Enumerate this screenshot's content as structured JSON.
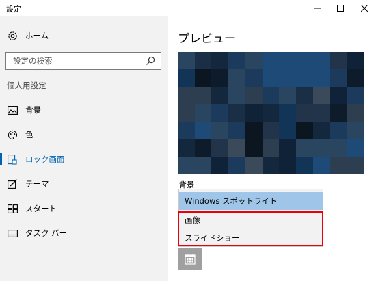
{
  "window": {
    "title": "設定"
  },
  "sidebar": {
    "home_label": "ホーム",
    "search_placeholder": "設定の検索",
    "section_header": "個人用設定",
    "items": [
      {
        "label": "背景"
      },
      {
        "label": "色"
      },
      {
        "label": "ロック画面"
      },
      {
        "label": "テーマ"
      },
      {
        "label": "スタート"
      },
      {
        "label": "タスク バー"
      }
    ],
    "active_item": "ロック画面"
  },
  "main": {
    "preview_title": "プレビュー",
    "background_label": "背景",
    "dropdown_options": [
      {
        "label": "Windows スポットライト",
        "selected": true
      },
      {
        "label": "画像",
        "selected": false
      },
      {
        "label": "スライドショー",
        "selected": false
      }
    ]
  },
  "colors": {
    "accent": "#0063b1",
    "selected_option": "#9fc6e8",
    "highlight_border": "#e8000b"
  }
}
